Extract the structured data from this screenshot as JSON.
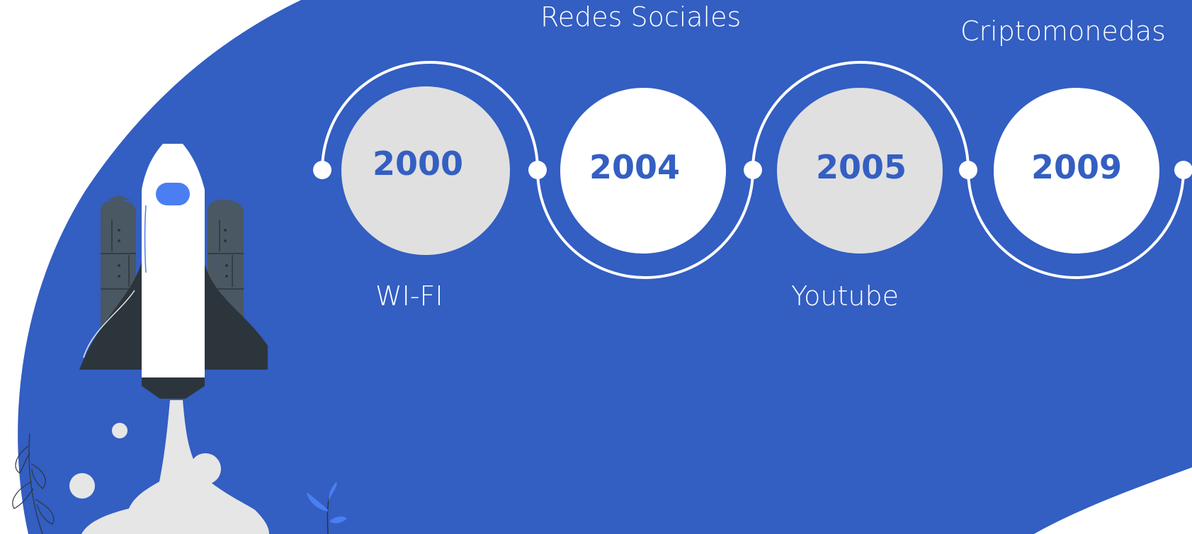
{
  "timeline": {
    "years": [
      "2000",
      "2004",
      "2005",
      "2009"
    ],
    "labels_top": [
      "Redes Sociales",
      "Criptomonedas"
    ],
    "labels_bottom": [
      "WI-FI",
      "Youtube"
    ]
  },
  "colors": {
    "background_blue": "#335ec2",
    "circle_light": "#e0e0e0",
    "circle_white": "#ffffff",
    "year_text": "#345fc2",
    "rocket_window": "#4a7ef2",
    "booster_dark": "#2d353c",
    "booster_grey": "#4a5863"
  },
  "icons": [
    "rocket-illustration",
    "plant-icon",
    "leaf-outline-icon",
    "smoke-cloud"
  ]
}
